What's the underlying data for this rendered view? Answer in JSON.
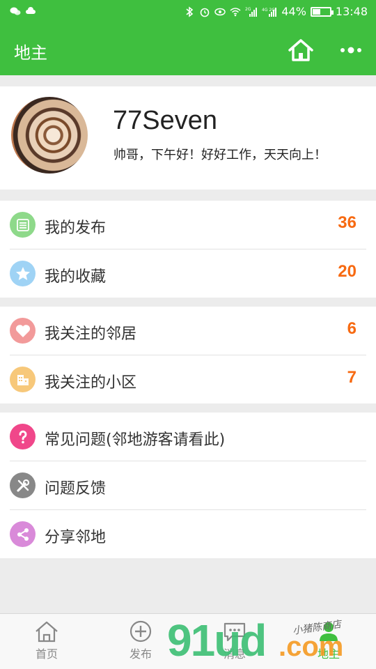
{
  "status_bar": {
    "battery_text": "44%",
    "battery_level": 0.44,
    "time": "13:48",
    "network_labels": [
      "2G",
      "4G 2G"
    ]
  },
  "title_bar": {
    "title": "地主",
    "icons": [
      "home-icon",
      "more-dots-icon"
    ]
  },
  "profile": {
    "nickname": "77Seven",
    "greeting": "帅哥，下午好！好好工作，天天向上！"
  },
  "group1": [
    {
      "label": "我的发布",
      "count": "36",
      "icon": "list-icon",
      "icon_color": "#8ed98a"
    },
    {
      "label": "我的收藏",
      "count": "20",
      "icon": "star-icon",
      "icon_color": "#9fd3f5"
    }
  ],
  "group2": [
    {
      "label": "我关注的邻居",
      "count": "6",
      "icon": "heart-icon",
      "icon_color": "#f29a9a"
    },
    {
      "label": "我关注的小区",
      "count": "7",
      "icon": "building-icon",
      "icon_color": "#f7c87a"
    }
  ],
  "group3": [
    {
      "label": "常见问题(邻地游客请看此)",
      "icon": "question-icon",
      "icon_color": "#f0478a"
    },
    {
      "label": "问题反馈",
      "icon": "tools-icon",
      "icon_color": "#888888"
    },
    {
      "label": "分享邻地",
      "icon": "share-icon",
      "icon_color": "#d98ad9"
    }
  ],
  "tabs": [
    {
      "label": "首页",
      "icon": "home-icon"
    },
    {
      "label": "发布",
      "icon": "plus-circle-icon"
    },
    {
      "label": "消息",
      "icon": "chat-icon"
    },
    {
      "label": "地主",
      "icon": "user-icon",
      "active": true
    }
  ],
  "watermark": {
    "brand": "91ud",
    "suffix": ".com",
    "script": "小猪陈商店"
  },
  "colors": {
    "accent": "#3fbf3f",
    "count": "#f76a12"
  }
}
